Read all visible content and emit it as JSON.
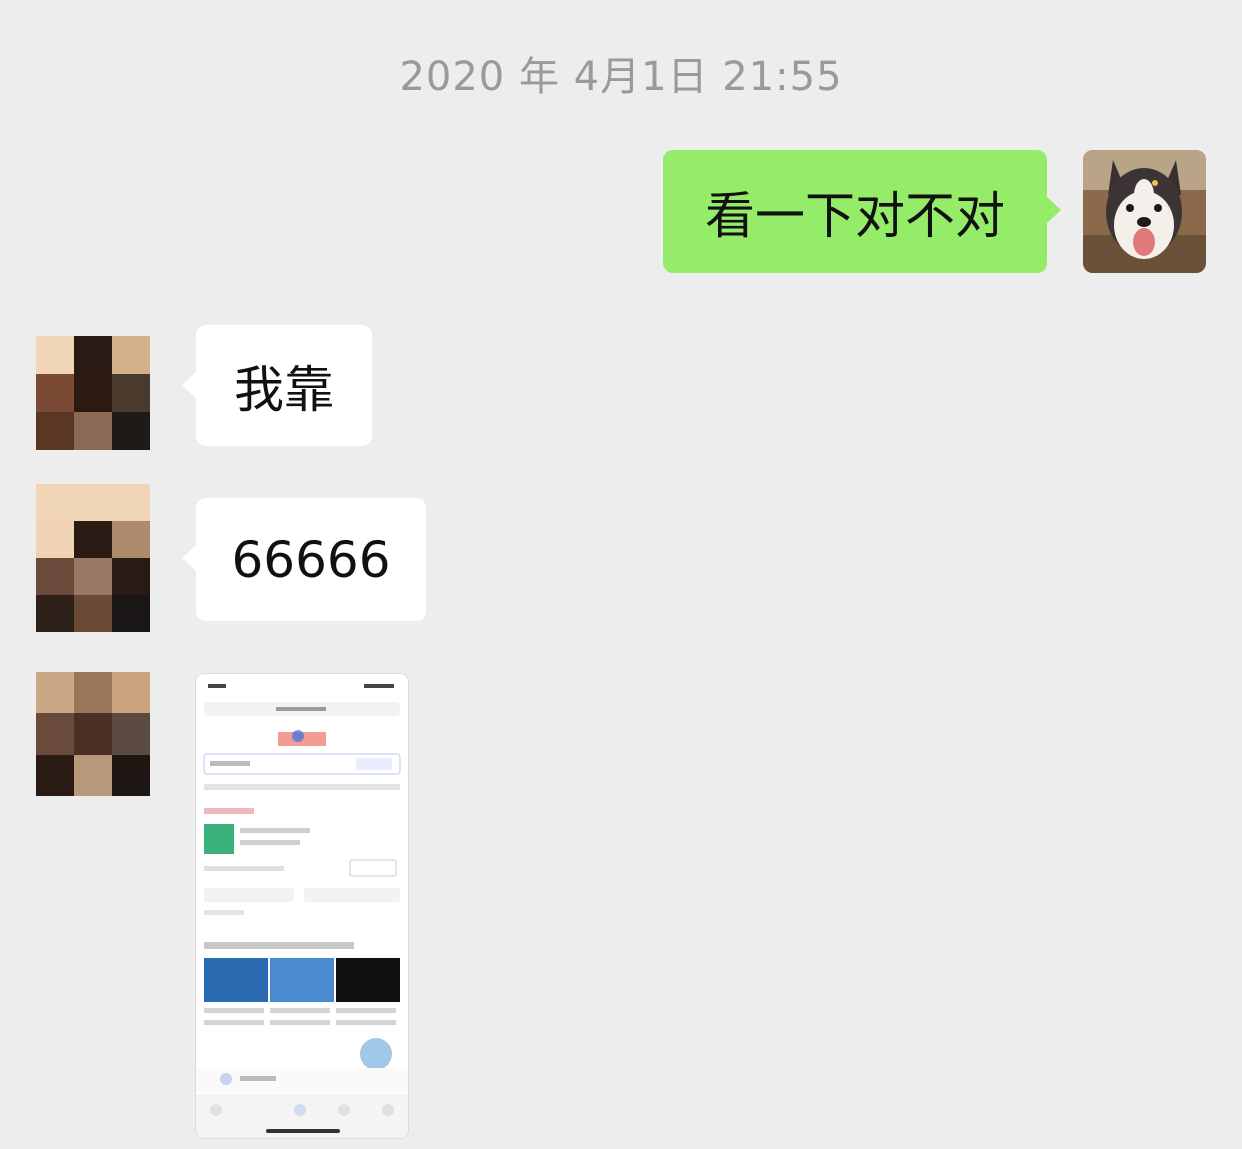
{
  "timestamp": "2020 年 4月1日 21:55",
  "messages": {
    "outgoing_1": "看一下对不对",
    "incoming_1": "我靠",
    "incoming_2": "66666"
  },
  "colors": {
    "background": "#ededed",
    "outgoing_bubble": "#95ec69",
    "incoming_bubble": "#ffffff",
    "timestamp_text": "#9a9a9a"
  },
  "icons": [
    "self-avatar",
    "contact-avatar",
    "screenshot-image"
  ]
}
